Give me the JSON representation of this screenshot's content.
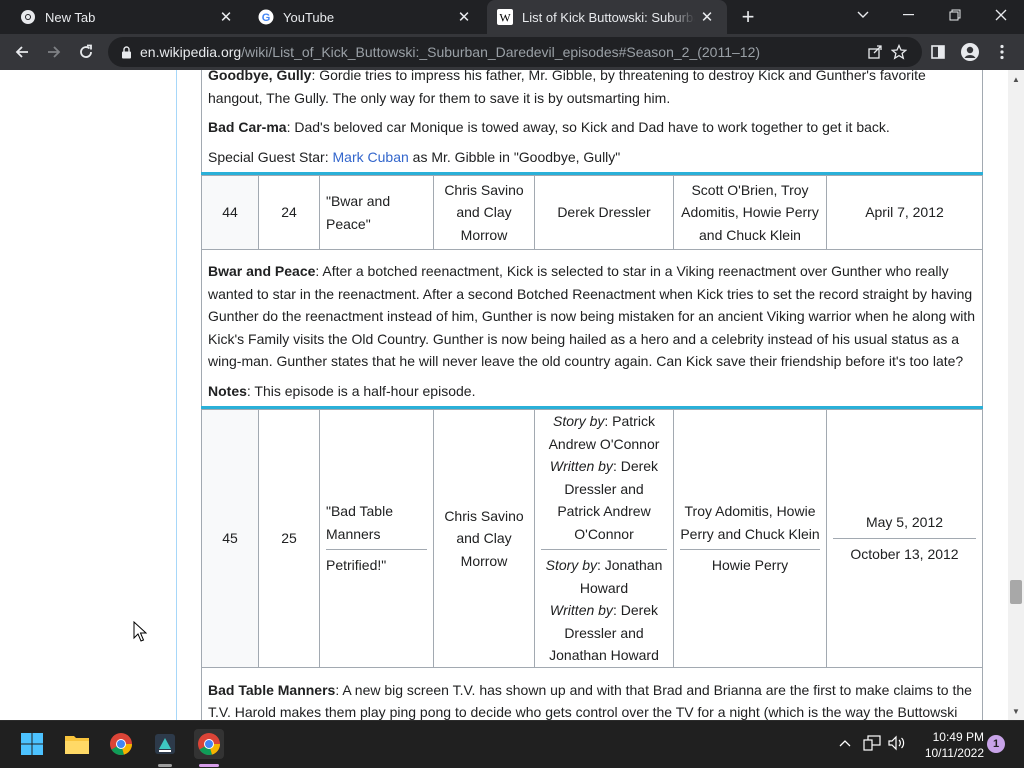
{
  "browser": {
    "tabs": [
      {
        "title": "New Tab",
        "active": false
      },
      {
        "title": "YouTube",
        "active": false
      },
      {
        "title": "List of Kick Buttowski: Suburban Daredevil episodes - Wikipedia",
        "active": true
      }
    ],
    "url_host": "en.wikipedia.org",
    "url_path": "/wiki/List_of_Kick_Buttowski:_Suburban_Daredevil_episodes#Season_2_(2011–12)"
  },
  "page": {
    "top_summary": {
      "p1_title": "Goodbye, Gully",
      "p1_text": ": Gordie tries to impress his father, Mr. Gibble, by threatening to destroy Kick and Gunther's favorite hangout, The Gully. The only way for them to save it is by outsmarting him.",
      "p2_title": "Bad Car-ma",
      "p2_text": ": Dad's beloved car Monique is towed away, so Kick and Dad have to work together to get it back.",
      "p3_prefix": "Special Guest Star: ",
      "p3_link": "Mark Cuban",
      "p3_suffix": " as Mr. Gibble in \"Goodbye, Gully\""
    },
    "ep44": {
      "overall": "44",
      "season": "24",
      "title": "\"Bwar and Peace\"",
      "directed": "Chris Savino and Clay Morrow",
      "written": "Derek Dressler",
      "storyboard": "Scott O'Brien, Troy Adomitis, Howie Perry and Chuck Klein",
      "airdate": "April 7, 2012",
      "summary_title": "Bwar and Peace",
      "summary_text": ": After a botched reenactment, Kick is selected to star in a Viking reenactment over Gunther who really wanted to star in the reenactment. After a second Botched Reenactment when Kick tries to set the record straight by having Gunther do the reenactment instead of him, Gunther is now being mistaken for an ancient Viking warrior when he along with Kick's Family visits the Old Country. Gunther is now being hailed as a hero and a celebrity instead of his usual status as a wing-man. Gunther states that he will never leave the old country again. Can Kick save their friendship before it's too late?",
      "notes_label": "Notes",
      "notes_text": ": This episode is a half-hour episode."
    },
    "ep45": {
      "overall": "45",
      "season": "25",
      "title_a": "\"Bad Table Manners",
      "title_b": "Petrified!\"",
      "directed": "Chris Savino and Clay Morrow",
      "written_a_story_label": "Story by",
      "written_a_story": ": Patrick Andrew O'Connor",
      "written_a_written_label": "Written by",
      "written_a_written": ": Derek Dressler and Patrick Andrew O'Connor",
      "written_b_story_label": "Story by",
      "written_b_story": ": Jonathan Howard",
      "written_b_written_label": "Written by",
      "written_b_written": ": Derek Dressler and Jonathan Howard",
      "storyboard_a": "Troy Adomitis, Howie Perry and Chuck Klein",
      "storyboard_b": "Howie Perry",
      "airdate_a": "May 5, 2012",
      "airdate_b": "October 13, 2012",
      "summary_title": "Bad Table Manners",
      "summary_text": ": A new big screen T.V. has shown up and with that Brad and Brianna are the first to make claims to the T.V. Harold makes them play ping pong to decide who gets control over the TV for a night (which is the way the Buttowski family used to settle things when Harold was younger rather than fighting). Brad and Brianna both have bad table manners"
    }
  },
  "taskbar": {
    "time": "10:49 PM",
    "date": "10/11/2022",
    "notification_count": "1",
    "apps": [
      "start-icon",
      "file-explorer-icon",
      "chrome-icon",
      "app-icon",
      "chrome-active-icon"
    ]
  },
  "colors": {
    "link": "#3366cc",
    "table_rule": "#2ab0d8",
    "border": "#a2a9b1"
  }
}
